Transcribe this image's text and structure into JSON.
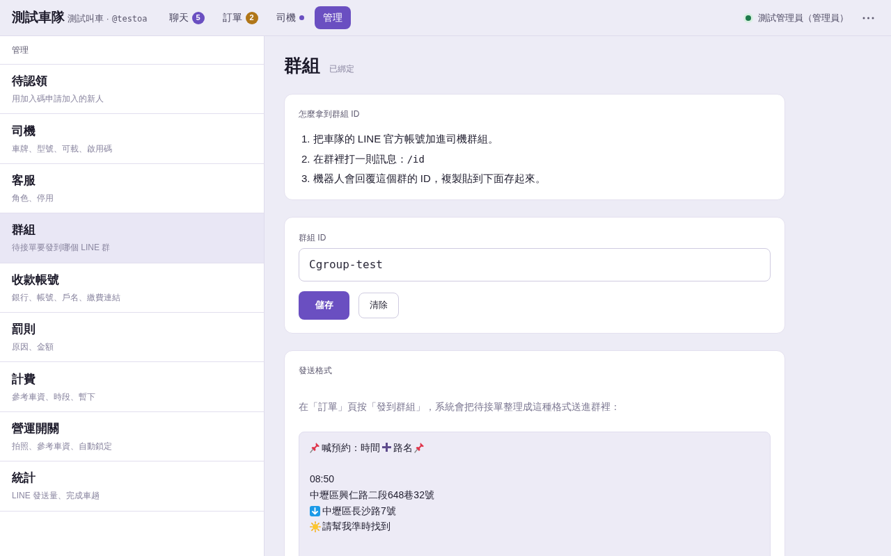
{
  "header": {
    "brand": "測試車隊",
    "subtitle": "測試叫車 ·",
    "handle": "@testoa"
  },
  "tabs": [
    {
      "label": "聊天",
      "selected": false,
      "kind": "count",
      "count": "5",
      "color": "#6a4fc1"
    },
    {
      "label": "訂單",
      "selected": false,
      "kind": "count",
      "count": "2",
      "color": "#b07618"
    },
    {
      "label": "司機",
      "selected": false,
      "kind": "dot",
      "color": "#6a4fc1"
    },
    {
      "label": "管理",
      "selected": true,
      "kind": "plain"
    }
  ],
  "user": {
    "name": "測試管理員（管理員）",
    "color": "#1e7a4c"
  },
  "sidebar": {
    "heading": "管理",
    "items": [
      {
        "title": "待認領",
        "description": "用加入碼申請加入的新人",
        "selected": false
      },
      {
        "title": "司機",
        "description": "車牌、型號、可載、啟用碼",
        "selected": false
      },
      {
        "title": "客服",
        "description": "角色、停用",
        "selected": false
      },
      {
        "title": "群組",
        "description": "待接單要發到哪個 LINE 群",
        "selected": true
      },
      {
        "title": "收款帳號",
        "description": "銀行、帳號、戶名、繳費連結",
        "selected": false
      },
      {
        "title": "罰則",
        "description": "原因、金額",
        "selected": false
      },
      {
        "title": "計費",
        "description": "參考車資、時段、暫下",
        "selected": false
      },
      {
        "title": "營運開關",
        "description": "拍照、參考車資、自動鎖定",
        "selected": false
      },
      {
        "title": "統計",
        "description": "LINE 發送量、完成車趟",
        "selected": false
      }
    ]
  },
  "page": {
    "title": "群組",
    "status": "已綁定"
  },
  "how_to": {
    "heading": "怎麼拿到群組 ID",
    "steps": [
      {
        "number": "1.",
        "text": "把車隊的 LINE 官方帳號加進司機群組。"
      },
      {
        "number": "2.",
        "text": "在群裡打一則訊息：",
        "code": "/id"
      },
      {
        "number": "3.",
        "text": "機器人會回覆這個群的 ID，複製貼到下面存起來。"
      }
    ]
  },
  "group_form": {
    "label": "群組 ID",
    "value": "Cgroup-test",
    "buttons": [
      {
        "label": "儲存",
        "kind": "primary"
      },
      {
        "label": "清除",
        "kind": "secondary"
      }
    ]
  },
  "format": {
    "heading": "發送格式",
    "description": "在「訂單」頁按「發到群組」，系統會把待接單整理成這種格式送進群裡：",
    "headline": {
      "lead": "喊預約：時間",
      "tail": "路名"
    },
    "orders": [
      {
        "time": "08:50",
        "pickup": "中壢區興仁路二段648巷32號",
        "dropoff": "中壢區長沙路7號",
        "note": "請幫我準時找到"
      }
    ]
  }
}
